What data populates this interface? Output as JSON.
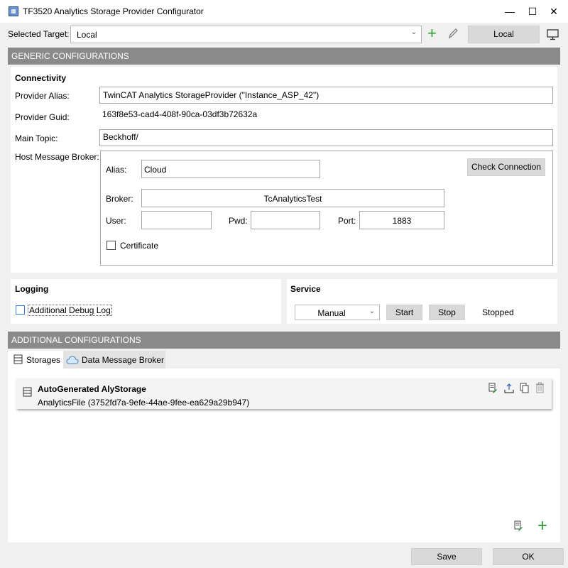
{
  "window": {
    "title": "TF3520 Analytics Storage Provider Configurator"
  },
  "target": {
    "label": "Selected Target:",
    "value": "Local",
    "local_button": "Local"
  },
  "generic": {
    "header": "GENERIC CONFIGURATIONS",
    "connectivity_title": "Connectivity",
    "provider_alias_label": "Provider Alias:",
    "provider_alias_value": "TwinCAT Analytics StorageProvider (\"Instance_ASP_42\")",
    "provider_guid_label": "Provider Guid:",
    "provider_guid_value": "163f8e53-cad4-408f-90ca-03df3b72632a",
    "main_topic_label": "Main Topic:",
    "main_topic_value": "Beckhoff/",
    "host_broker_label": "Host Message Broker:",
    "broker": {
      "alias_label": "Alias:",
      "alias_value": "Cloud",
      "check_button": "Check Connection",
      "broker_label": "Broker:",
      "broker_value": "TcAnalyticsTest",
      "user_label": "User:",
      "user_value": "",
      "pwd_label": "Pwd:",
      "pwd_value": "",
      "port_label": "Port:",
      "port_value": "1883",
      "certificate_label": "Certificate"
    }
  },
  "logging": {
    "title": "Logging",
    "debug_label": "Additional Debug Log"
  },
  "service": {
    "title": "Service",
    "mode": "Manual",
    "start": "Start",
    "stop": "Stop",
    "status": "Stopped"
  },
  "additional": {
    "header": "ADDITIONAL CONFIGURATIONS",
    "tabs": [
      "Storages",
      "Data Message Broker"
    ],
    "storage_item": {
      "name": "AutoGenerated AlyStorage",
      "detail": "AnalyticsFile (3752fd7a-9efe-44ae-9fee-ea629a29b947)"
    }
  },
  "footer": {
    "save": "Save",
    "ok": "OK"
  }
}
